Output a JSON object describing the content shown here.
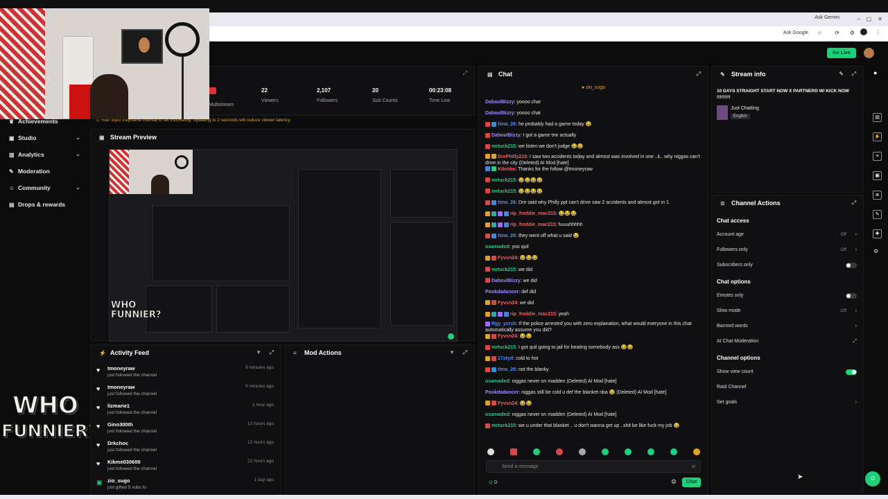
{
  "browser": {
    "gemini_label": "Ask Gemini",
    "google_label": "Ask Google"
  },
  "header": {
    "go_live_label": "Go Live"
  },
  "sidebar": {
    "items": [
      {
        "label": "Achievements",
        "icon": "trophy-icon",
        "chevron": false
      },
      {
        "label": "Studio",
        "icon": "video-icon",
        "chevron": true
      },
      {
        "label": "Analytics",
        "icon": "chart-icon",
        "chevron": true
      },
      {
        "label": "Moderation",
        "icon": "wrench-icon",
        "chevron": false
      },
      {
        "label": "Community",
        "icon": "people-icon",
        "chevron": true
      },
      {
        "label": "Drops & rewards",
        "icon": "gift-icon",
        "chevron": false
      }
    ],
    "logo_line1": "WHO",
    "logo_line2": "FUNNIER?"
  },
  "stats": {
    "multistream_label": "Multistream",
    "items": [
      {
        "value": "22",
        "label": "Viewers"
      },
      {
        "value": "2,107",
        "label": "Followers"
      },
      {
        "value": "20",
        "label": "Sub Counts"
      },
      {
        "value": "00:23:08",
        "label": "Time Live"
      }
    ],
    "warning": "Your input Keyframe interval is set incorrectly. Updating to 2 seconds will reduce viewer latency."
  },
  "stream_preview": {
    "title": "Stream Preview"
  },
  "activity_feed": {
    "title": "Activity Feed",
    "items": [
      {
        "name": "tmoneyraw",
        "action": "just followed the channel",
        "time": "8 minutes ago"
      },
      {
        "name": "tmoneyraw",
        "action": "just followed the channel",
        "time": "9 minutes ago"
      },
      {
        "name": "lizmarie1",
        "action": "just followed the channel",
        "time": "1 hour ago"
      },
      {
        "name": "Gino300th",
        "action": "just followed the channel",
        "time": "12 hours ago"
      },
      {
        "name": "Drkchoc",
        "action": "just followed the channel",
        "time": "12 hours ago"
      },
      {
        "name": "Kikme030609",
        "action": "just followed the channel",
        "time": "12 hours ago"
      },
      {
        "name": "zio_sugo",
        "action": "just gifted 5 subs to",
        "time": "1 day ago"
      }
    ]
  },
  "mod_actions": {
    "title": "Mod Actions"
  },
  "chat": {
    "title": "Chat",
    "pinned_user": "zio_sugo",
    "messages": [
      {
        "user": "DaboulBizzy",
        "color": "#9b8cff",
        "badges": [],
        "text": "yoooo char"
      },
      {
        "user": "DaboulBizzy",
        "color": "#9b8cff",
        "badges": [],
        "text": "yoooo chat"
      },
      {
        "user": "tima_26",
        "color": "#4a8cff",
        "badges": [
          "#d94848",
          "#3b8bdb"
        ],
        "text": "he probably had a game today 😂"
      },
      {
        "user": "DaboulBizzy",
        "color": "#9b8cff",
        "badges": [
          "#d94848"
        ],
        "text": "I got a game tmr actually"
      },
      {
        "user": "mrtuck215",
        "color": "#1fd07a",
        "badges": [
          "#d94848"
        ],
        "text": "we listen we don't judge 😂😂"
      },
      {
        "user": "DrePhilly215",
        "color": "#ff5b5b",
        "badges": [
          "#e0a323",
          "#e0a323"
        ],
        "text": "I saw two accidents today and almost was involved in one ..k.. why niggas can't drive in the city (Deleted) AI Mod [hate]"
      },
      {
        "user": "Kikmba",
        "color": "#ff5b5b",
        "badges": [
          "#3b8bdb",
          "#1fd07a"
        ],
        "text": "Thanks for the follow @tmoneyraw"
      },
      {
        "user": "mrtuck215",
        "color": "#1fd07a",
        "badges": [
          "#d94848"
        ],
        "text": "😂😂😂😂"
      },
      {
        "user": "mrtuck215",
        "color": "#1fd07a",
        "badges": [
          "#d94848"
        ],
        "text": "😂😂😂😂"
      },
      {
        "user": "tima_26",
        "color": "#4a8cff",
        "badges": [
          "#d94848",
          "#3b8bdb"
        ],
        "text": "Dre said why Philly ppl can't drive saw 2 accidents and almost got in 1"
      },
      {
        "user": "rip_freddie_mac215",
        "color": "#ff5b5b",
        "badges": [
          "#e0a323",
          "#2fa7a7",
          "#9b6cff",
          "#3b8bdb"
        ],
        "text": "😂😂😂"
      },
      {
        "user": "rip_freddie_mac215",
        "color": "#ff5b5b",
        "badges": [
          "#e0a323",
          "#2fa7a7",
          "#9b6cff",
          "#3b8bdb"
        ],
        "text": "huuuhhhhh"
      },
      {
        "user": "tima_26",
        "color": "#4a8cff",
        "badges": [
          "#d94848",
          "#3b8bdb"
        ],
        "text": "they went off what u said 😂"
      },
      {
        "user": "osamaded",
        "color": "#1fd07a",
        "badges": [],
        "text": "yoo quil"
      },
      {
        "user": "Fyvsn24",
        "color": "#ff5b5b",
        "badges": [
          "#e0a323",
          "#d94848"
        ],
        "text": "😂😂😂"
      },
      {
        "user": "mrtuck215",
        "color": "#1fd07a",
        "badges": [
          "#d94848"
        ],
        "text": "we did"
      },
      {
        "user": "DaboulBizzy",
        "color": "#9b8cff",
        "badges": [
          "#d94848"
        ],
        "text": "we did"
      },
      {
        "user": "Pookdadancer",
        "color": "#9b8cff",
        "badges": [],
        "text": "def did"
      },
      {
        "user": "Fyvsn24",
        "color": "#ff5b5b",
        "badges": [
          "#e0a323",
          "#d94848"
        ],
        "text": "we did"
      },
      {
        "user": "rip_freddie_mac215",
        "color": "#ff5b5b",
        "badges": [
          "#e0a323",
          "#2fa7a7",
          "#9b6cff",
          "#3b8bdb"
        ],
        "text": "yeah"
      },
      {
        "user": "Rgy_yzrsh",
        "color": "#4a8cff",
        "badges": [
          "#9b6cff"
        ],
        "text": "If the police arrested you with zero explanation, what would everyone in this chat automatically assume you did?"
      },
      {
        "user": "Fyvsn24",
        "color": "#ff5b5b",
        "badges": [
          "#e0a323",
          "#d94848"
        ],
        "text": "😂😂"
      },
      {
        "user": "mrtuck215",
        "color": "#1fd07a",
        "badges": [
          "#d94848"
        ],
        "text": "I got quil going to jail for beating somebody ass 😂😂"
      },
      {
        "user": "17styd",
        "color": "#4a8cff",
        "badges": [
          "#e0a323",
          "#d94848"
        ],
        "text": "cold to hot"
      },
      {
        "user": "tima_26",
        "color": "#4a8cff",
        "badges": [
          "#d94848",
          "#3b8bdb"
        ],
        "text": "not the blanky"
      },
      {
        "user": "osamaded",
        "color": "#1fd07a",
        "badges": [],
        "text": "niggas never on madden (Deleted) AI Mod [hate]"
      },
      {
        "user": "Pookdadancer",
        "color": "#9b8cff",
        "badges": [],
        "text": "niggas still be cold u def the blanket nba 😂 (Deleted) AI Mod [hate]"
      },
      {
        "user": "Fyvsn24",
        "color": "#ff5b5b",
        "badges": [
          "#e0a323",
          "#d94848"
        ],
        "text": "😂😂"
      },
      {
        "user": "osamaded",
        "color": "#1fd07a",
        "badges": [],
        "text": "niggas never on madden (Deleted) AI Mod [hate]"
      },
      {
        "user": "mrtuck215",
        "color": "#1fd07a",
        "badges": [
          "#d94848"
        ],
        "text": "we u under that blanket .. u don't wanna get up ..shit be like fuck my job 😂"
      }
    ],
    "input_placeholder": "Send a message",
    "viewer_count": "0",
    "send_label": "Chat"
  },
  "stream_info": {
    "title": "Stream info",
    "stream_title": "10 DAYS STRAIGHT START NOW X PARTNERD W/ KICK NOW !!!!!!!!!",
    "category": "Just Chatting",
    "language": "English"
  },
  "channel_actions": {
    "title": "Channel Actions",
    "sections": [
      {
        "label": "Chat access",
        "rows": [
          {
            "label": "Account age",
            "value": "Off",
            "kind": "arrow"
          },
          {
            "label": "Followers only",
            "value": "Off",
            "kind": "arrow"
          },
          {
            "label": "Subscribers only",
            "value": "",
            "kind": "toggle-off"
          }
        ]
      },
      {
        "label": "Chat options",
        "rows": [
          {
            "label": "Emotes only",
            "value": "",
            "kind": "toggle-off"
          },
          {
            "label": "Slow mode",
            "value": "Off",
            "kind": "arrow"
          },
          {
            "label": "Banned words",
            "value": "",
            "kind": "arrow"
          },
          {
            "label": "AI Chat Moderation",
            "value": "",
            "kind": "external"
          }
        ]
      },
      {
        "label": "Channel options",
        "rows": [
          {
            "label": "Show view count",
            "value": "",
            "kind": "toggle-on"
          },
          {
            "label": "Raid Channel",
            "value": "",
            "kind": "none"
          },
          {
            "label": "Set goals",
            "value": "",
            "kind": "arrow"
          }
        ]
      }
    ]
  },
  "colors": {
    "accent": "#1fd07a",
    "warning": "#d9a640",
    "panel": "#101012",
    "background": "#0b0b0c"
  }
}
